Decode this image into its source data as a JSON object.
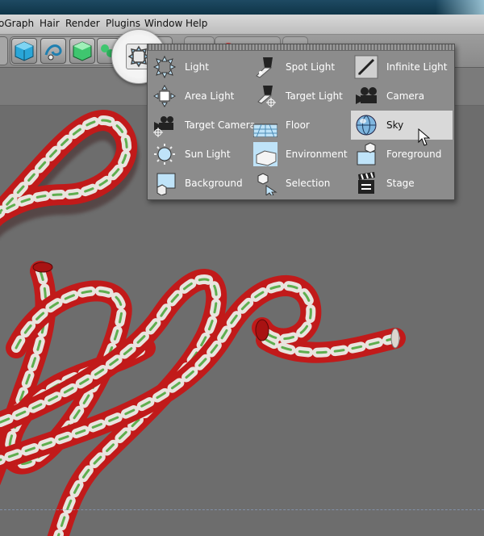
{
  "menubar": {
    "items": [
      "oGraph",
      "Hair",
      "Render",
      "Plugins",
      "Window",
      "Help"
    ]
  },
  "light_popup": {
    "columns": [
      [
        {
          "label": "Light",
          "icon": "light-icon"
        },
        {
          "label": "Area Light",
          "icon": "area-light-icon"
        },
        {
          "label": "Target Camera",
          "icon": "target-camera-icon"
        },
        {
          "label": "Sun Light",
          "icon": "sun-light-icon"
        },
        {
          "label": "Background",
          "icon": "background-icon"
        }
      ],
      [
        {
          "label": "Spot Light",
          "icon": "spot-light-icon"
        },
        {
          "label": "Target Light",
          "icon": "target-light-icon"
        },
        {
          "label": "Floor",
          "icon": "floor-icon"
        },
        {
          "label": "Environment",
          "icon": "environment-icon"
        },
        {
          "label": "Selection",
          "icon": "selection-icon"
        }
      ],
      [
        {
          "label": "Infinite Light",
          "icon": "infinite-light-icon"
        },
        {
          "label": "Camera",
          "icon": "camera-icon"
        },
        {
          "label": "Sky",
          "icon": "sky-icon",
          "selected": true
        },
        {
          "label": "Foreground",
          "icon": "foreground-icon"
        },
        {
          "label": "Stage",
          "icon": "stage-icon"
        }
      ]
    ]
  },
  "colors": {
    "cane_red": "#cc1f1f",
    "cane_white": "#e9e4df",
    "cane_green": "#5fae4f",
    "selected_bg": "#d9d9d9"
  }
}
